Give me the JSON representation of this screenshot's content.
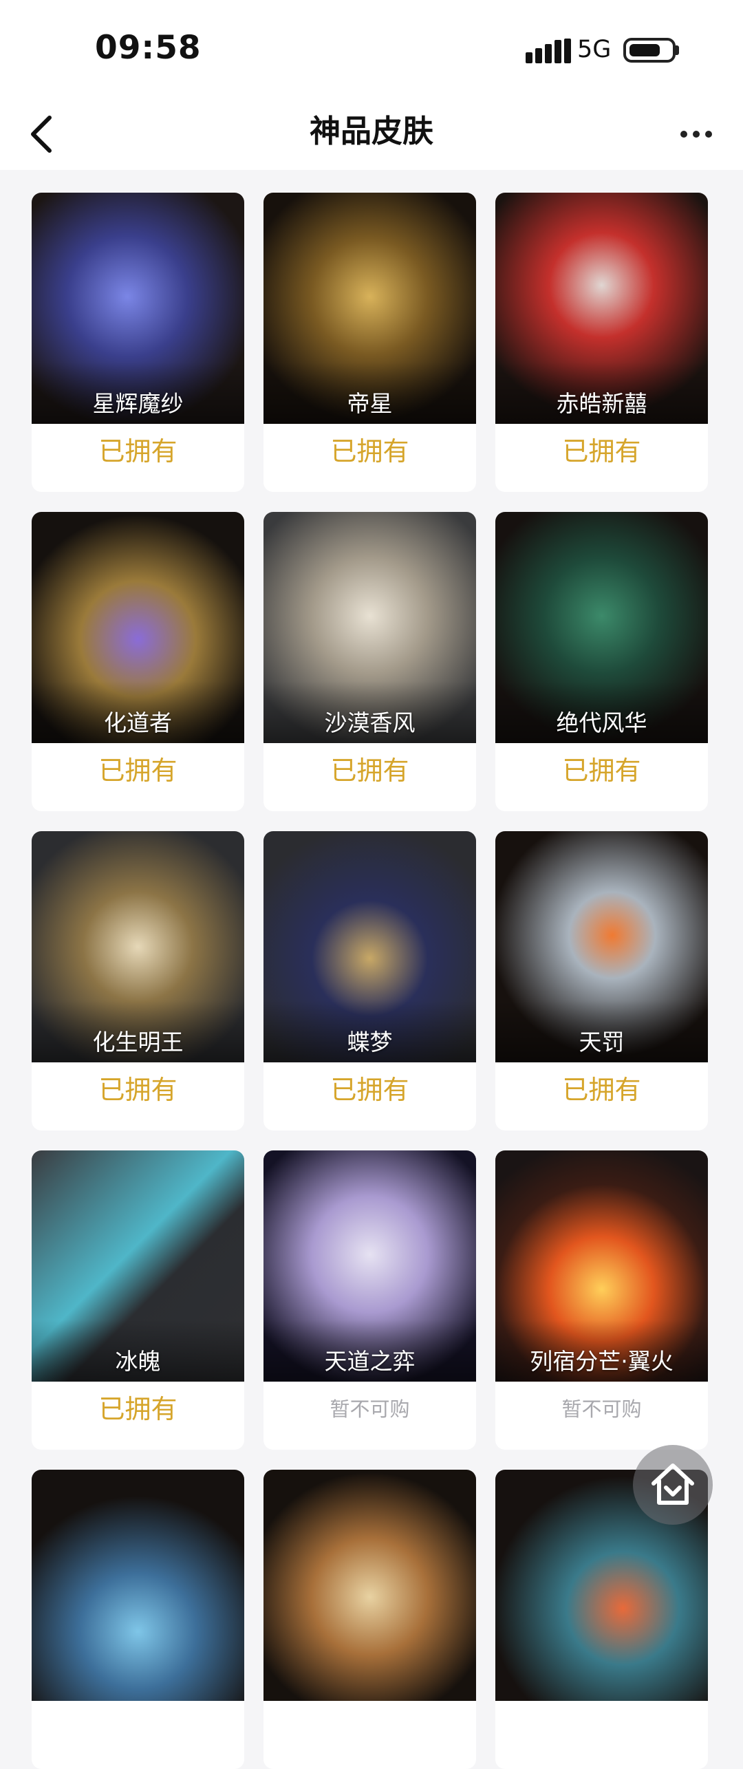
{
  "status_bar": {
    "time": "09:58",
    "network": "5G"
  },
  "header": {
    "title": "神品皮肤"
  },
  "status_labels": {
    "owned": "已拥有",
    "unavailable": "暂不可购"
  },
  "skins": [
    {
      "name": "星辉魔纱",
      "status": "已拥有"
    },
    {
      "name": "帝星",
      "status": "已拥有"
    },
    {
      "name": "赤皓新囍",
      "status": "已拥有"
    },
    {
      "name": "化道者",
      "status": "已拥有"
    },
    {
      "name": "沙漠香风",
      "status": "已拥有"
    },
    {
      "name": "绝代风华",
      "status": "已拥有"
    },
    {
      "name": "化生明王",
      "status": "已拥有"
    },
    {
      "name": "蝶梦",
      "status": "已拥有"
    },
    {
      "name": "天罚",
      "status": "已拥有"
    },
    {
      "name": "冰魄",
      "status": "已拥有"
    },
    {
      "name": "天道之弈",
      "status": "暂不可购"
    },
    {
      "name": "列宿分芒·翼火",
      "status": "暂不可购"
    }
  ],
  "colors": {
    "owned": "#d6a52b",
    "unavailable": "#a8a8ad",
    "page_background": "#f5f5f7"
  },
  "icons": {
    "back": "chevron-left-icon",
    "more": "more-horizontal-icon",
    "home": "home-icon"
  }
}
